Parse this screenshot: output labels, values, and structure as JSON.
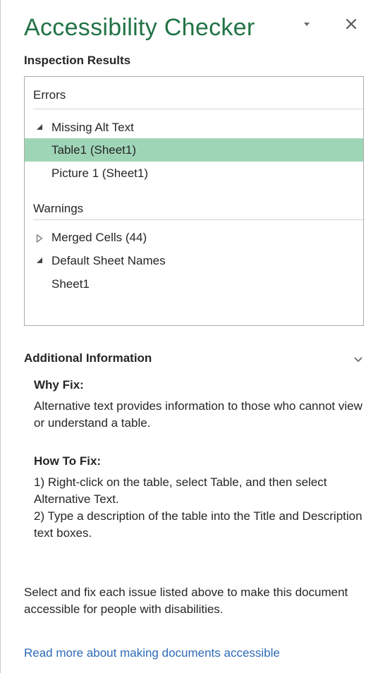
{
  "pane": {
    "title": "Accessibility Checker",
    "menu_icon": "dropdown-triangle-icon",
    "close_icon": "close-icon"
  },
  "inspection": {
    "heading": "Inspection Results",
    "errors_label": "Errors",
    "warnings_label": "Warnings",
    "rows": [
      {
        "label": "Missing Alt Text",
        "toggle": "expanded"
      },
      {
        "label": "Table1 (Sheet1)",
        "selected": true
      },
      {
        "label": "Picture 1 (Sheet1)"
      },
      {
        "label": "Merged Cells (44)",
        "toggle": "collapsed"
      },
      {
        "label": "Default Sheet Names",
        "toggle": "expanded"
      },
      {
        "label": "Sheet1"
      }
    ]
  },
  "additional": {
    "heading": "Additional Information",
    "chevron_icon": "chevron-down-icon",
    "why_fix_heading": "Why Fix:",
    "why_fix_text": "Alternative text provides information to those who cannot view or understand a table.",
    "how_to_fix_heading": "How To Fix:",
    "how_to_fix_step1": "1) Right-click on the table, select Table, and then select Alternative Text.",
    "how_to_fix_step2": "2) Type a description of the table into the Title and Description text boxes.",
    "footer_text": "Select and fix each issue listed above to make this document accessible for people with disabilities.",
    "read_more_link": "Read more about making documents accessible"
  },
  "colors": {
    "title_green": "#217346",
    "selection_green": "#9fd5b7",
    "link_blue": "#2e6ab6"
  }
}
